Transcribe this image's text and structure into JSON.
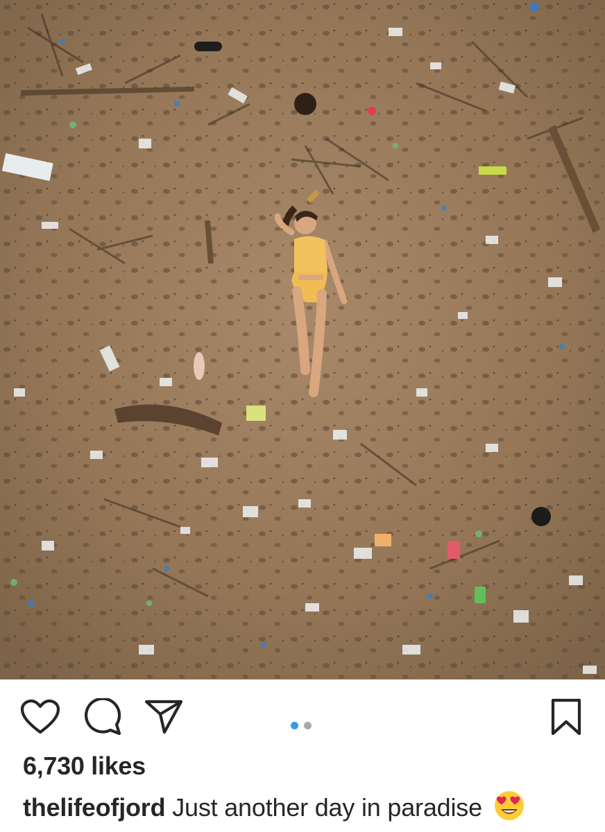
{
  "post": {
    "image": {
      "description_icon": "aerial-beach-photo",
      "carousel": {
        "total": 2,
        "current": 1
      }
    },
    "actions": {
      "like_icon": "heart-outline-icon",
      "comment_icon": "speech-bubble-icon",
      "share_icon": "paper-plane-icon",
      "save_icon": "bookmark-outline-icon"
    },
    "likes_text": "6,730 likes",
    "caption": {
      "username": "thelifeofjord",
      "text": "Just another day in paradise",
      "emoji_icon": "heart-eyes-emoji"
    },
    "colors": {
      "accent_dot": "#3897f0",
      "inactive_dot": "#a8a8a8",
      "text": "#262626"
    }
  }
}
